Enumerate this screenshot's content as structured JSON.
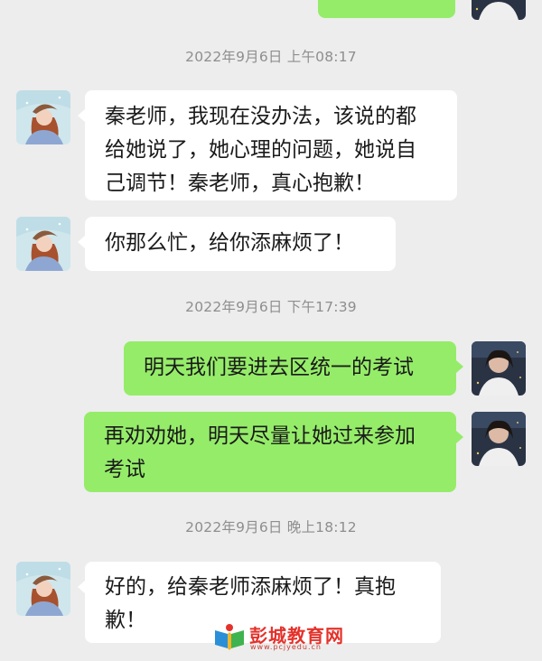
{
  "messages": [
    {
      "kind": "outgoing_partial"
    },
    {
      "kind": "timestamp",
      "text": "2022年9月6日 上午08:17"
    },
    {
      "kind": "incoming",
      "lines": [
        "秦老师，我现在没办法，该说的都",
        "给她说了，她心理的问题，她说自",
        "己调节！秦老师，真心抱歉！"
      ]
    },
    {
      "kind": "incoming",
      "lines": [
        "你那么忙，给你添麻烦了！"
      ]
    },
    {
      "kind": "timestamp",
      "text": "2022年9月6日 下午17:39"
    },
    {
      "kind": "outgoing",
      "lines": [
        "明天我们要进去区统一的考试"
      ]
    },
    {
      "kind": "outgoing",
      "lines": [
        "再劝劝她，明天尽量让她过来参加",
        "考试"
      ]
    },
    {
      "kind": "timestamp",
      "text": "2022年9月6日 晚上18:12"
    },
    {
      "kind": "incoming",
      "lines": [
        "好的，给秦老师添麻烦了！真抱",
        "歉！"
      ]
    }
  ],
  "colors": {
    "background": "#ededed",
    "incoming_bubble": "#ffffff",
    "outgoing_bubble": "#95ec69",
    "timestamp_text": "#8e8e8e",
    "watermark_red": "#e4322b"
  },
  "watermark": {
    "name": "彭城教育网",
    "url": "www.pcjyedu.cn"
  },
  "icons": {
    "incoming_avatar": "illustrated-girl-avatar",
    "outgoing_avatar": "photo-girl-avatar",
    "watermark_logo": "book-logo-icon"
  }
}
